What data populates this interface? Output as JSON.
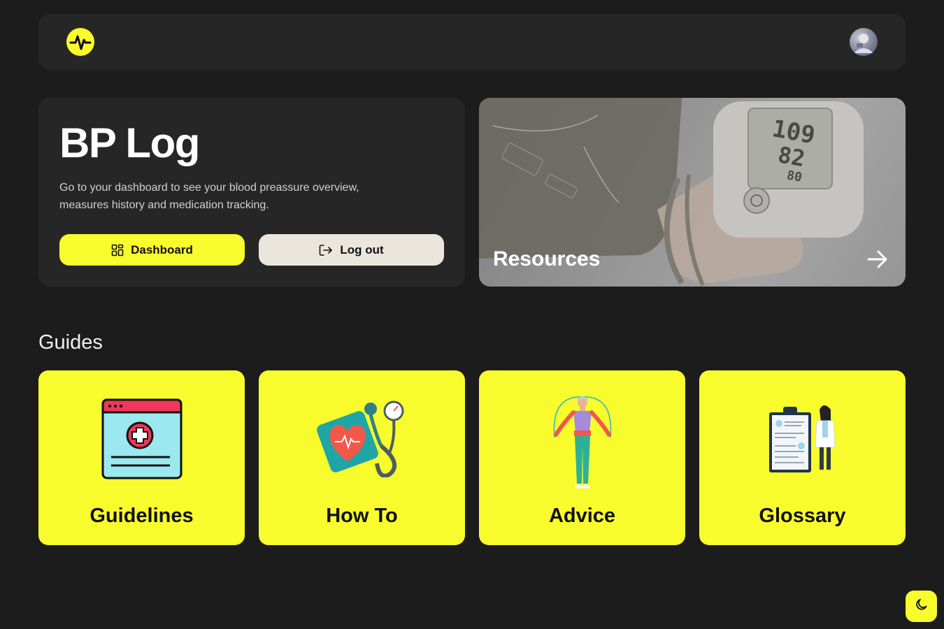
{
  "colors": {
    "background": "#1d1c1d",
    "panel": "#262626",
    "accent": "#f9fc2c",
    "secondary_button": "#ebe6dc"
  },
  "header": {
    "logo_icon": "heartbeat-icon",
    "avatar_icon": "user-avatar"
  },
  "hero": {
    "title": "BP Log",
    "description": "Go to your dashboard to see your blood preassure overview, measures history and medication tracking.",
    "dashboard_label": "Dashboard",
    "dashboard_icon": "grid-icon",
    "logout_label": "Log out",
    "logout_icon": "logout-icon"
  },
  "resources": {
    "label": "Resources",
    "arrow_icon": "arrow-right-icon"
  },
  "guides": {
    "title": "Guides",
    "cards": [
      {
        "label": "Guidelines",
        "icon": "medical-window-icon"
      },
      {
        "label": "How To",
        "icon": "blood-pressure-monitor-icon"
      },
      {
        "label": "Advice",
        "icon": "jump-rope-person-icon"
      },
      {
        "label": "Glossary",
        "icon": "clipboard-doctor-icon"
      }
    ]
  },
  "theme_toggle": {
    "icon": "moon-icon"
  }
}
